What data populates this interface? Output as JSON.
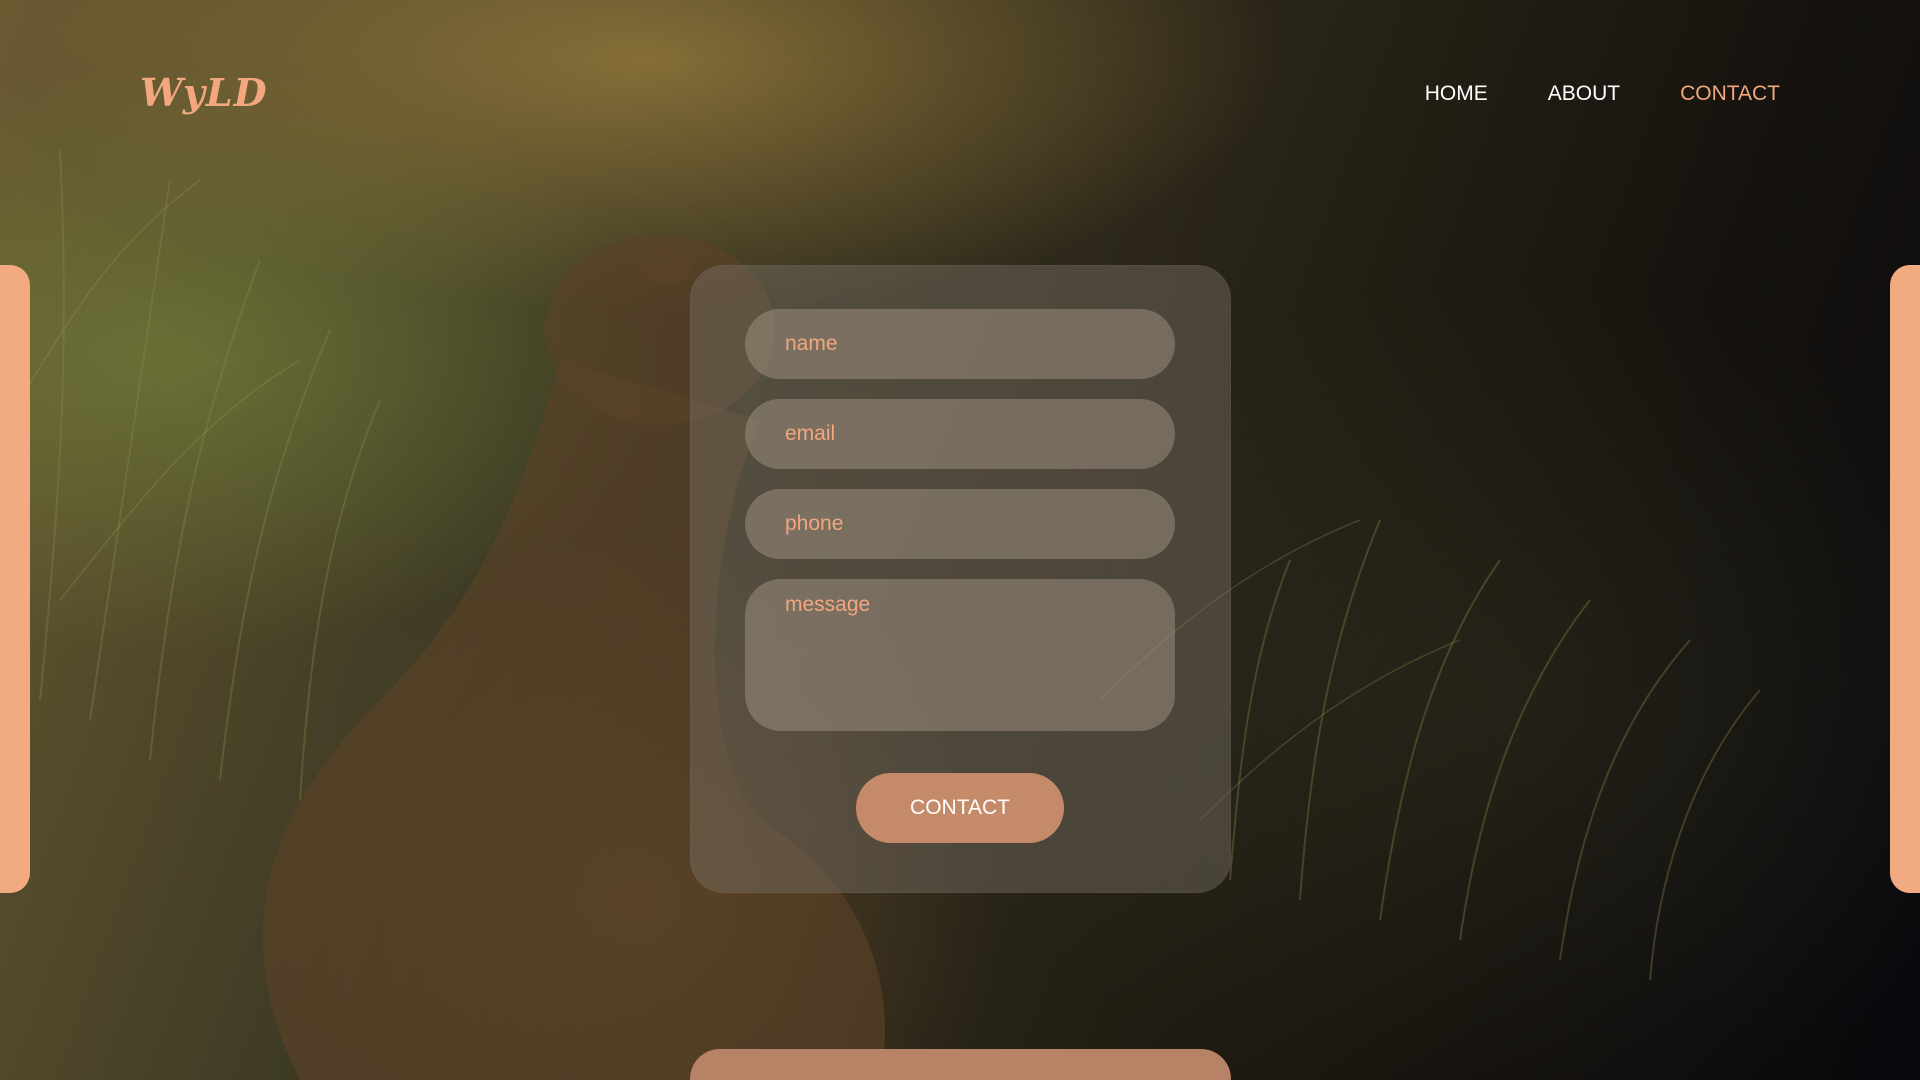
{
  "brand": {
    "logo_text": "WyLD"
  },
  "nav": {
    "items": [
      {
        "label": "HOME"
      },
      {
        "label": "ABOUT"
      },
      {
        "label": "CONTACT"
      }
    ],
    "active_index": 2
  },
  "form": {
    "name_placeholder": "name",
    "email_placeholder": "email",
    "phone_placeholder": "phone",
    "message_placeholder": "message",
    "submit_label": "CONTACT"
  },
  "colors": {
    "accent": "#f2a77f",
    "button": "#c58a6a",
    "side_bars": "#f2aa80"
  }
}
